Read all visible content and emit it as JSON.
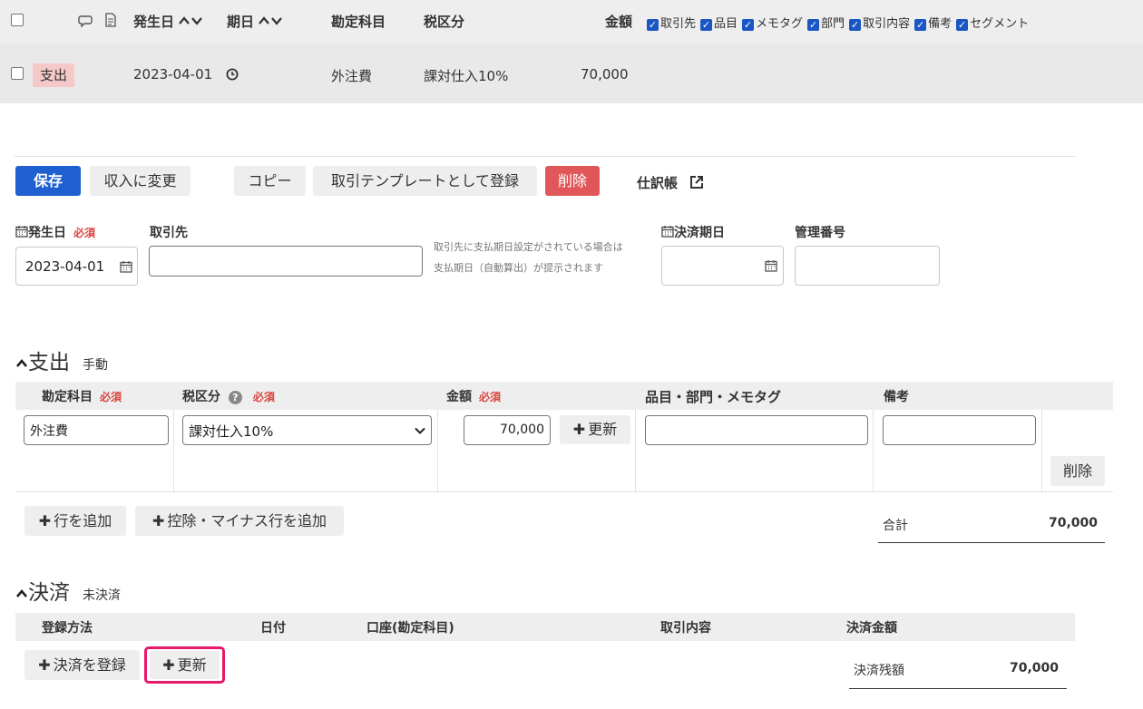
{
  "list_header": {
    "occurred_date": "発生日",
    "due_date": "期日",
    "account_item": "勘定科目",
    "tax_category": "税区分",
    "amount": "金額",
    "sort_icon": "sort-arrows-icon",
    "column_options": [
      "取引先",
      "品目",
      "メモタグ",
      "部門",
      "取引内容",
      "備考",
      "セグメント"
    ]
  },
  "list_row": {
    "type_badge": "支出",
    "date": "2023-04-01",
    "account": "外注費",
    "tax": "課対仕入10%",
    "amount": "70,000"
  },
  "toolbar": {
    "save": "保存",
    "change_to_income": "収入に変更",
    "copy": "コピー",
    "register_template": "取引テンプレートとして登録",
    "delete": "削除",
    "journal": "仕訳帳"
  },
  "form": {
    "occurred_date_label": "発生日",
    "required": "必須",
    "occurred_date_value": "2023-04-01",
    "partner_label": "取引先",
    "partner_value": "",
    "partner_hint_1": "取引先に支払期日設定がされている場合は",
    "partner_hint_2": "支払期日（自動算出）が提示されます",
    "settlement_due_label": "決済期日",
    "settlement_due_value": "",
    "management_number_label": "管理番号",
    "management_number_value": ""
  },
  "expense": {
    "title": "支出",
    "mode": "手動",
    "headers": {
      "account": "勘定科目",
      "tax": "税区分",
      "amount": "金額",
      "items": "品目・部門・メモタグ",
      "remarks": "備考"
    },
    "row": {
      "account": "外注費",
      "tax": "課対仕入10%",
      "amount": "70,000",
      "update": "更新",
      "items": "",
      "remarks": "",
      "delete": "削除"
    },
    "add_row": "行を追加",
    "add_deduction_row": "控除・マイナス行を追加",
    "total_label": "合計",
    "total_value": "70,000"
  },
  "settlement": {
    "title": "決済",
    "status": "未決済",
    "headers": {
      "method": "登録方法",
      "date": "日付",
      "account": "口座(勘定科目)",
      "description": "取引内容",
      "amount": "決済金額"
    },
    "register": "決済を登録",
    "update": "更新",
    "remaining_label": "決済残額",
    "remaining_value": "70,000"
  },
  "colors": {
    "primary": "#1f5fd0",
    "danger": "#e15759",
    "badge_bg": "#f6c9c9",
    "highlight": "#e8186a"
  }
}
